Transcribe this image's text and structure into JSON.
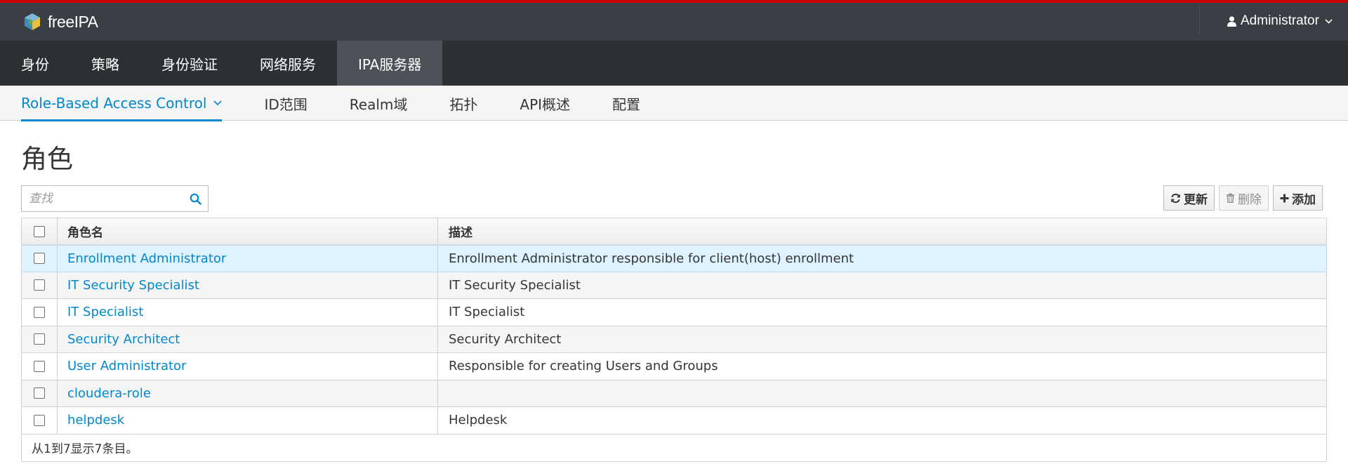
{
  "brand": {
    "name": "freeIPA",
    "logo": "freeipa-logo-icon"
  },
  "user_menu": {
    "label": "Administrator",
    "icon": "user-icon"
  },
  "primary_nav": [
    {
      "label": "身份",
      "active": false
    },
    {
      "label": "策略",
      "active": false
    },
    {
      "label": "身份验证",
      "active": false
    },
    {
      "label": "网络服务",
      "active": false
    },
    {
      "label": "IPA服务器",
      "active": true
    }
  ],
  "secondary_nav": [
    {
      "label": "Role-Based Access Control",
      "active": true,
      "dropdown": true
    },
    {
      "label": "ID范围",
      "active": false
    },
    {
      "label": "Realm域",
      "active": false
    },
    {
      "label": "拓扑",
      "active": false
    },
    {
      "label": "API概述",
      "active": false
    },
    {
      "label": "配置",
      "active": false
    }
  ],
  "page": {
    "title": "角色"
  },
  "search": {
    "placeholder": "查找",
    "value": ""
  },
  "toolbar": {
    "refresh_label": "更新",
    "delete_label": "删除",
    "add_label": "添加"
  },
  "table": {
    "columns": [
      "角色名",
      "描述"
    ],
    "rows": [
      {
        "name": "Enrollment Administrator",
        "description": "Enrollment Administrator responsible for client(host) enrollment",
        "selected": true
      },
      {
        "name": "IT Security Specialist",
        "description": "IT Security Specialist",
        "selected": false
      },
      {
        "name": "IT Specialist",
        "description": "IT Specialist",
        "selected": false
      },
      {
        "name": "Security Architect",
        "description": "Security Architect",
        "selected": false
      },
      {
        "name": "User Administrator",
        "description": "Responsible for creating Users and Groups",
        "selected": false
      },
      {
        "name": "cloudera-role",
        "description": "",
        "selected": false
      },
      {
        "name": "helpdesk",
        "description": "Helpdesk",
        "selected": false
      }
    ],
    "footer": "从1到7显示7条目。"
  },
  "colors": {
    "accent": "#0088ce",
    "topbar": "#393f44",
    "nav": "#2c3033",
    "brand_stripe": "#cc0000",
    "selected_row": "#def3ff"
  }
}
